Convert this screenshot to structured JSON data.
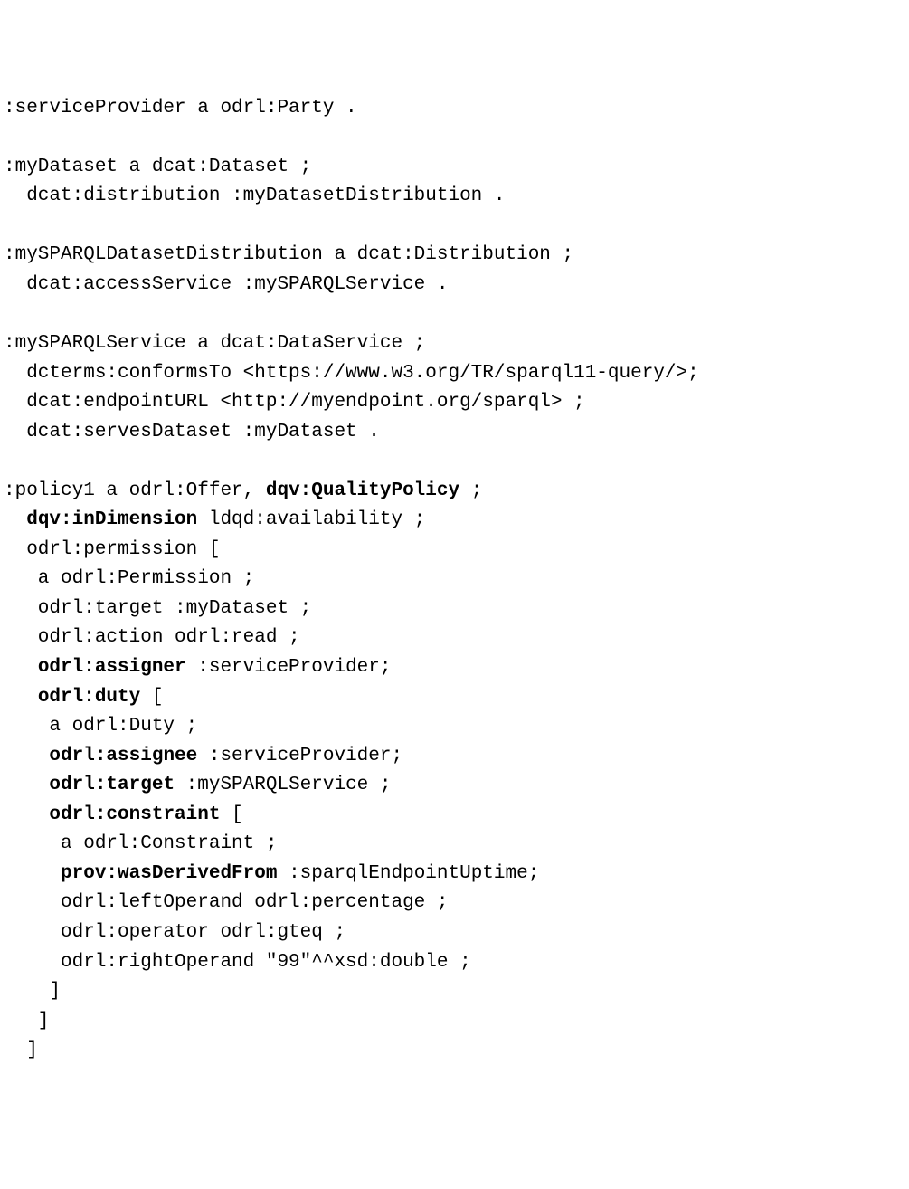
{
  "lines": [
    [
      {
        "t": ":serviceProvider a odrl:Party .",
        "b": false
      }
    ],
    [
      {
        "t": "",
        "b": false
      }
    ],
    [
      {
        "t": ":myDataset a dcat:Dataset ;",
        "b": false
      }
    ],
    [
      {
        "t": "  dcat:distribution :myDatasetDistribution .",
        "b": false
      }
    ],
    [
      {
        "t": "",
        "b": false
      }
    ],
    [
      {
        "t": ":mySPARQLDatasetDistribution a dcat:Distribution ;",
        "b": false
      }
    ],
    [
      {
        "t": "  dcat:accessService :mySPARQLService .",
        "b": false
      }
    ],
    [
      {
        "t": "",
        "b": false
      }
    ],
    [
      {
        "t": ":mySPARQLService a dcat:DataService ;",
        "b": false
      }
    ],
    [
      {
        "t": "  dcterms:conformsTo <https://www.w3.org/TR/sparql11-query/>;",
        "b": false
      }
    ],
    [
      {
        "t": "  dcat:endpointURL <http://myendpoint.org/sparql> ;",
        "b": false
      }
    ],
    [
      {
        "t": "  dcat:servesDataset :myDataset .",
        "b": false
      }
    ],
    [
      {
        "t": "",
        "b": false
      }
    ],
    [
      {
        "t": ":policy1 a odrl:Offer, ",
        "b": false
      },
      {
        "t": "dqv:QualityPolicy",
        "b": true
      },
      {
        "t": " ;",
        "b": false
      }
    ],
    [
      {
        "t": "  ",
        "b": false
      },
      {
        "t": "dqv:inDimension",
        "b": true
      },
      {
        "t": " ldqd:availability ;",
        "b": false
      }
    ],
    [
      {
        "t": "  odrl:permission [",
        "b": false
      }
    ],
    [
      {
        "t": "   a odrl:Permission ;",
        "b": false
      }
    ],
    [
      {
        "t": "   odrl:target :myDataset ;",
        "b": false
      }
    ],
    [
      {
        "t": "   odrl:action odrl:read ;",
        "b": false
      }
    ],
    [
      {
        "t": "   ",
        "b": false
      },
      {
        "t": "odrl:assigner",
        "b": true
      },
      {
        "t": " :serviceProvider;",
        "b": false
      }
    ],
    [
      {
        "t": "   ",
        "b": false
      },
      {
        "t": "odrl:duty",
        "b": true
      },
      {
        "t": " [",
        "b": false
      }
    ],
    [
      {
        "t": "    a odrl:Duty ;",
        "b": false
      }
    ],
    [
      {
        "t": "    ",
        "b": false
      },
      {
        "t": "odrl:assignee",
        "b": true
      },
      {
        "t": " :serviceProvider;",
        "b": false
      }
    ],
    [
      {
        "t": "    ",
        "b": false
      },
      {
        "t": "odrl:target",
        "b": true
      },
      {
        "t": " :mySPARQLService ;",
        "b": false
      }
    ],
    [
      {
        "t": "    ",
        "b": false
      },
      {
        "t": "odrl:constraint",
        "b": true
      },
      {
        "t": " [",
        "b": false
      }
    ],
    [
      {
        "t": "     a odrl:Constraint ;",
        "b": false
      }
    ],
    [
      {
        "t": "     ",
        "b": false
      },
      {
        "t": "prov:wasDerivedFrom",
        "b": true
      },
      {
        "t": " :sparqlEndpointUptime;",
        "b": false
      }
    ],
    [
      {
        "t": "     odrl:leftOperand odrl:percentage ;",
        "b": false
      }
    ],
    [
      {
        "t": "     odrl:operator odrl:gteq ;",
        "b": false
      }
    ],
    [
      {
        "t": "     odrl:rightOperand \"99\"^^xsd:double ;",
        "b": false
      }
    ],
    [
      {
        "t": "    ]",
        "b": false
      }
    ],
    [
      {
        "t": "   ]",
        "b": false
      }
    ],
    [
      {
        "t": "  ]",
        "b": false
      }
    ]
  ]
}
